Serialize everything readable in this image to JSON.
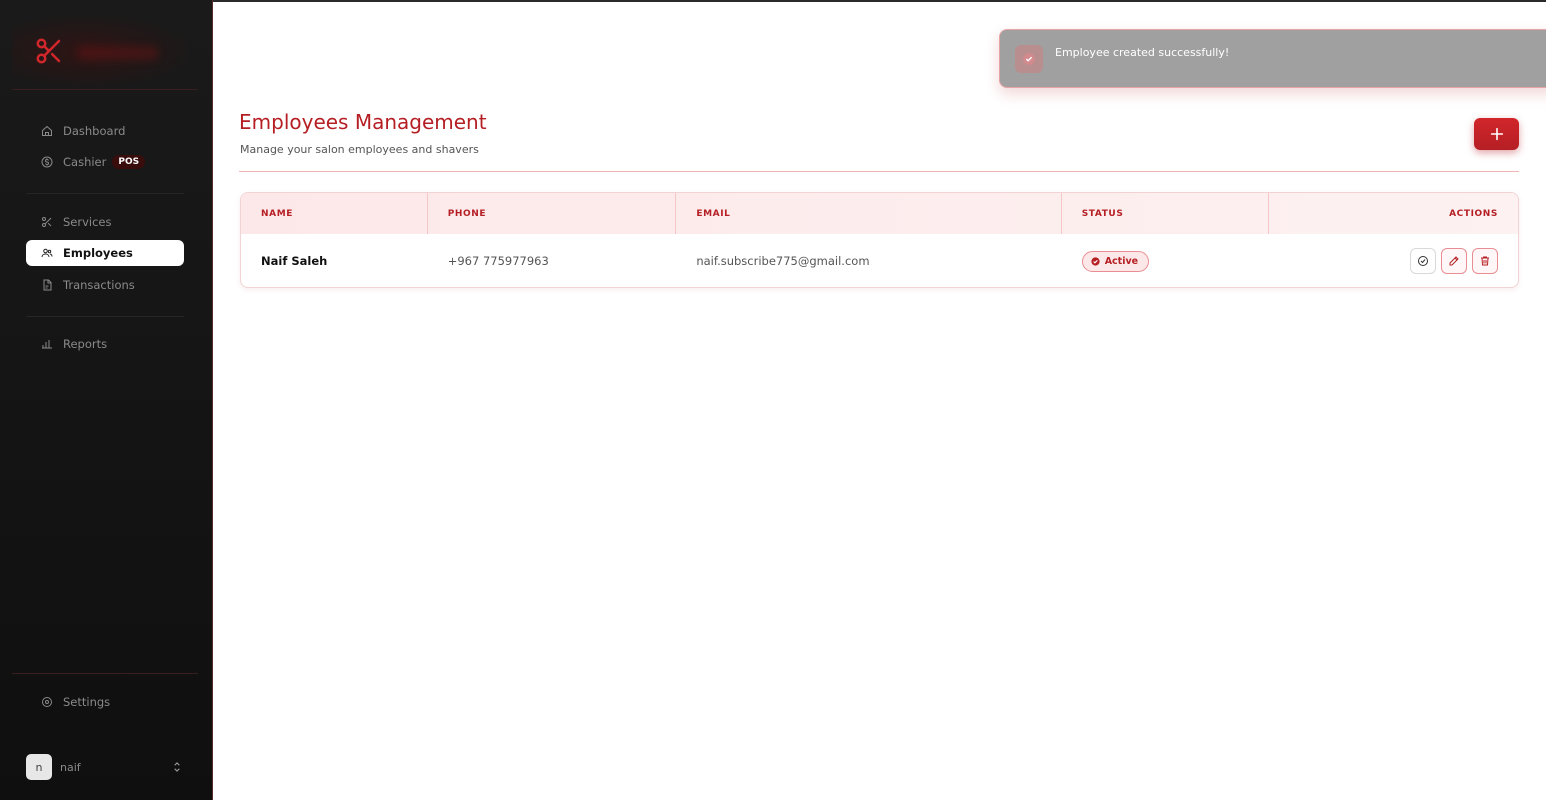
{
  "sidebar": {
    "nav_group1": [
      {
        "label": "Dashboard",
        "icon": "home-icon"
      },
      {
        "label": "Cashier",
        "icon": "dollar-icon",
        "badge": "POS"
      }
    ],
    "nav_group2": [
      {
        "label": "Services",
        "icon": "scissors-icon"
      },
      {
        "label": "Employees",
        "icon": "users-icon",
        "active": true
      },
      {
        "label": "Transactions",
        "icon": "file-icon"
      }
    ],
    "nav_group3": [
      {
        "label": "Reports",
        "icon": "bar-chart-icon"
      }
    ],
    "settings": {
      "label": "Settings",
      "icon": "gear-icon"
    },
    "user": {
      "initial": "n",
      "name": "naif"
    }
  },
  "header": {
    "title": "Employees Management",
    "subtitle": "Manage your salon employees and shavers",
    "add_icon": "plus-icon"
  },
  "table": {
    "columns": [
      "NAME",
      "PHONE",
      "EMAIL",
      "STATUS",
      "ACTIONS"
    ],
    "rows": [
      {
        "name": "Naif Saleh",
        "phone": "+967 775977963",
        "email": "naif.subscribe775@gmail.com",
        "status": "Active"
      }
    ]
  },
  "toast": {
    "message": "Employee created successfully!",
    "icon": "check-circle-icon"
  },
  "colors": {
    "accent": "#b51f24",
    "sidebar_bg": "#141414",
    "badge_bg": "#fde8e9"
  }
}
